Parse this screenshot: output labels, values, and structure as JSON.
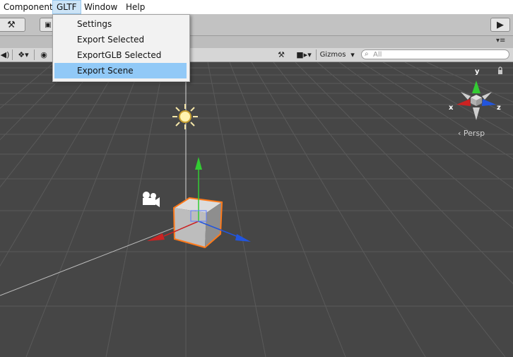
{
  "menubar": {
    "items": [
      {
        "label": "Component",
        "active": false
      },
      {
        "label": "GLTF",
        "active": true
      },
      {
        "label": "Window",
        "active": false
      },
      {
        "label": "Help",
        "active": false
      }
    ]
  },
  "gltf_menu": {
    "items": [
      {
        "label": "Settings",
        "highlighted": false
      },
      {
        "label": "Export Selected",
        "highlighted": false
      },
      {
        "label": "ExportGLB Selected",
        "highlighted": false
      },
      {
        "label": "Export Scene",
        "highlighted": true
      }
    ]
  },
  "scene_toolbar": {
    "gizmos_label": "Gizmos",
    "search_placeholder": "All"
  },
  "scene": {
    "projection_label": "Persp",
    "axes": {
      "x": "x",
      "y": "y",
      "z": "z"
    },
    "colors": {
      "background": "#464646",
      "grid": "#5a5a5a",
      "x_axis": "#cc2222",
      "y_axis": "#33cc33",
      "z_axis": "#2255dd",
      "selection": "#ff7a1a"
    }
  }
}
